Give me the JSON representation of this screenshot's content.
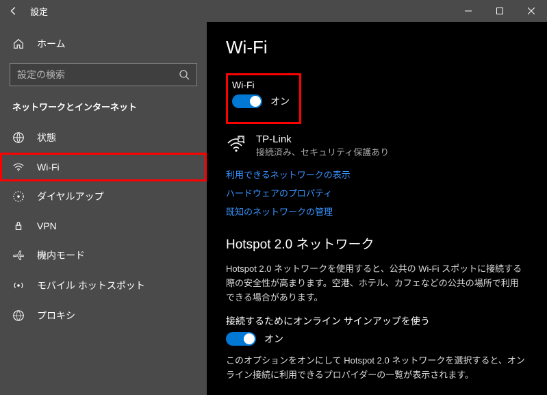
{
  "titlebar": {
    "title": "設定"
  },
  "sidebar": {
    "home": "ホーム",
    "search_placeholder": "設定の検索",
    "heading": "ネットワークとインターネット",
    "items": [
      {
        "label": "状態"
      },
      {
        "label": "Wi-Fi"
      },
      {
        "label": "ダイヤルアップ"
      },
      {
        "label": "VPN"
      },
      {
        "label": "機内モード"
      },
      {
        "label": "モバイル ホットスポット"
      },
      {
        "label": "プロキシ"
      }
    ]
  },
  "main": {
    "title": "Wi-Fi",
    "wifi_toggle": {
      "label": "Wi-Fi",
      "state": "オン"
    },
    "network": {
      "name": "TP-Link",
      "status": "接続済み、セキュリティ保護あり"
    },
    "links": {
      "show_networks": "利用できるネットワークの表示",
      "hw_props": "ハードウェアのプロパティ",
      "known_networks": "既知のネットワークの管理"
    },
    "hotspot": {
      "title": "Hotspot 2.0 ネットワーク",
      "desc": "Hotspot 2.0 ネットワークを使用すると、公共の Wi-Fi スポットに接続する際の安全性が高まります。空港、ホテル、カフェなどの公共の場所で利用できる場合があります。",
      "online_signup_label": "接続するためにオンライン サインアップを使う",
      "toggle_state": "オン",
      "footer": "このオプションをオンにして Hotspot 2.0 ネットワークを選択すると、オンライン接続に利用できるプロバイダーの一覧が表示されます。"
    }
  }
}
